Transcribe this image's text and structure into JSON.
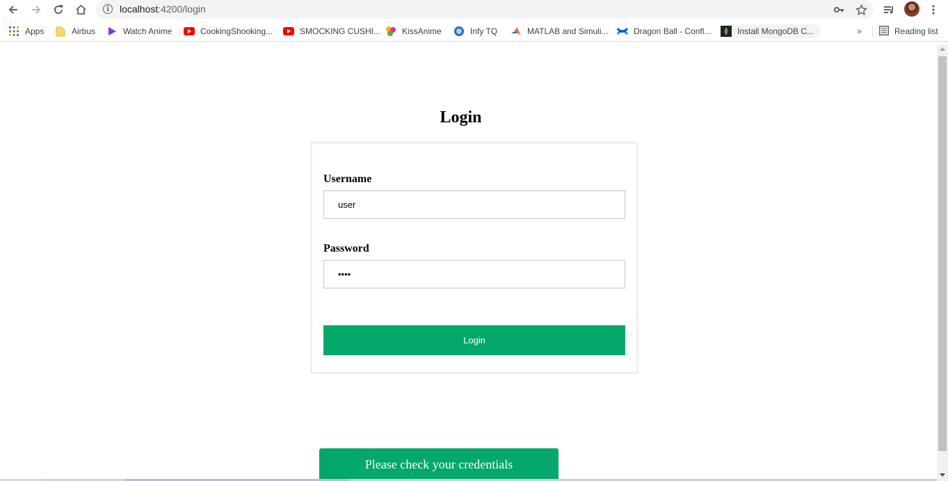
{
  "browser": {
    "url_host": "localhost",
    "url_path": ":4200/login",
    "bookmarks": [
      {
        "label": "Apps",
        "icon": "apps-grid-icon"
      },
      {
        "label": "Airbus",
        "icon": "folder-icon"
      },
      {
        "label": "Watch Anime",
        "icon": "play-icon"
      },
      {
        "label": "CookingShooking...",
        "icon": "youtube-icon"
      },
      {
        "label": "SMOCKING CUSHI...",
        "icon": "youtube-icon"
      },
      {
        "label": "KissAnime",
        "icon": "kissanime-icon"
      },
      {
        "label": "Infy TQ",
        "icon": "infytq-icon"
      },
      {
        "label": "MATLAB and Simuli...",
        "icon": "matlab-icon"
      },
      {
        "label": "Dragon Ball - Confl...",
        "icon": "confluence-icon"
      },
      {
        "label": "Install MongoDB C...",
        "icon": "mongodb-icon"
      }
    ],
    "reading_list": "Reading list",
    "more_bookmarks": "»"
  },
  "page": {
    "title": "Login",
    "username_label": "Username",
    "username_value": "user",
    "password_label": "Password",
    "password_value": "••••",
    "login_button": "Login",
    "toast_message": "Please check your credentials"
  },
  "colors": {
    "accent": "#03a86a",
    "card_border": "#efefef"
  }
}
